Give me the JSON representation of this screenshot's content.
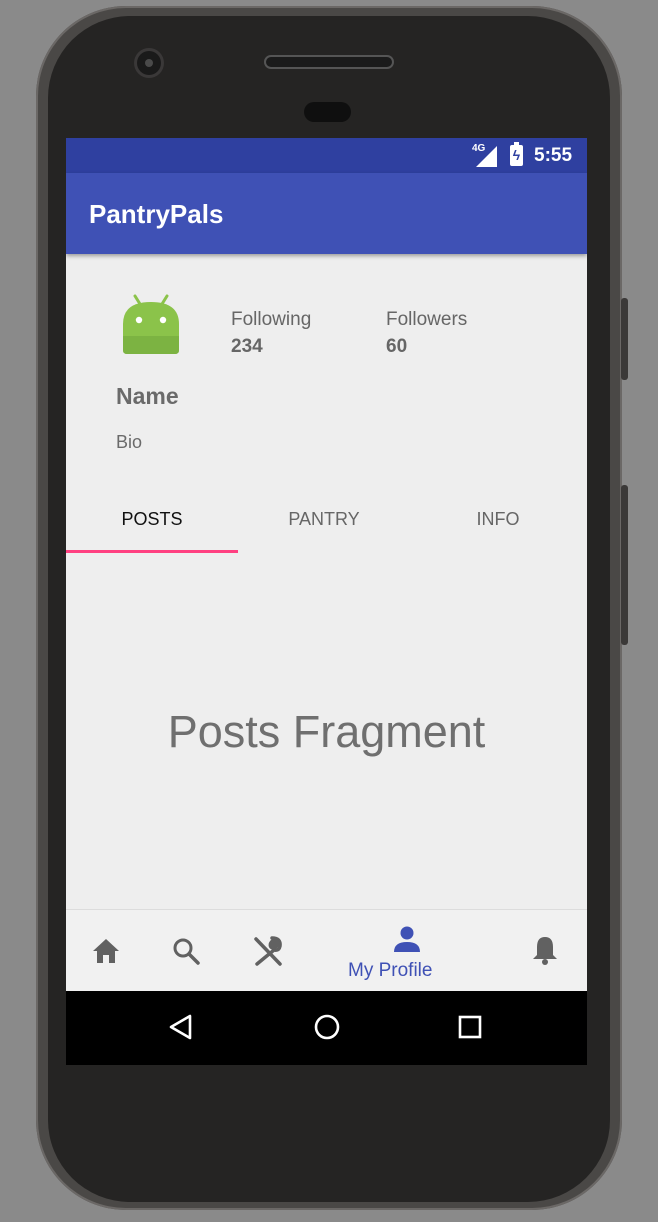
{
  "status_bar": {
    "network": "4G",
    "time": "5:55",
    "network_icon": "signal-icon",
    "battery_icon": "battery-charging-icon"
  },
  "app_bar": {
    "title": "PantryPals"
  },
  "profile": {
    "avatar_icon": "android-avatar-icon",
    "following_label": "Following",
    "following_count": "234",
    "followers_label": "Followers",
    "followers_count": "60",
    "name": "Name",
    "bio": "Bio"
  },
  "tabs": [
    {
      "label": "POSTS",
      "active": true
    },
    {
      "label": "PANTRY",
      "active": false
    },
    {
      "label": "INFO",
      "active": false
    }
  ],
  "content": {
    "fragment_text": "Posts Fragment"
  },
  "bottom_nav": {
    "items": [
      {
        "icon": "home-icon",
        "label": ""
      },
      {
        "icon": "search-icon",
        "label": ""
      },
      {
        "icon": "utensils-icon",
        "label": ""
      },
      {
        "icon": "person-icon",
        "label": "My Profile",
        "active": true
      },
      {
        "icon": "bell-icon",
        "label": ""
      }
    ]
  },
  "system_nav": {
    "back_icon": "back-triangle-icon",
    "home_icon": "home-circle-icon",
    "recents_icon": "recents-square-icon"
  },
  "colors": {
    "status_bar": "#2f40a0",
    "app_bar": "#3f51b5",
    "tab_indicator": "#ff4081",
    "background": "#eeeeee",
    "active_nav": "#3f51b5"
  }
}
